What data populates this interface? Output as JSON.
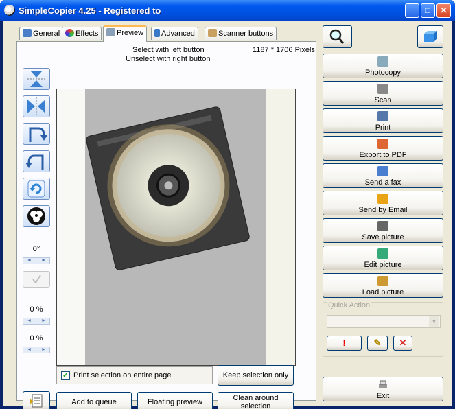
{
  "window": {
    "title": "SimpleCopier 4.25 - Registered to",
    "minimize": "_",
    "maximize": "□",
    "close": "✕"
  },
  "tabs": [
    {
      "label": "General",
      "icon": "general-tab-icon"
    },
    {
      "label": "Effects",
      "icon": "effects-tab-icon"
    },
    {
      "label": "Preview",
      "icon": "preview-tab-icon",
      "active": true
    },
    {
      "label": "Advanced",
      "icon": "advanced-tab-icon"
    },
    {
      "label": "Scanner buttons",
      "icon": "scanner-buttons-tab-icon"
    }
  ],
  "preview": {
    "instructions_line1": "Select with left button",
    "instructions_line2": "Unselect with right button",
    "dimensions": "1187 * 1706 Pixels"
  },
  "side_tools": {
    "rotation_value": "0°",
    "brightness_value": "0 %",
    "contrast_value": "0 %"
  },
  "bottom": {
    "print_selection_label": "Print selection on entire page",
    "print_selection_checked": true,
    "keep_selection_label": "Keep selection only",
    "add_queue_label": "Add to queue",
    "floating_preview_label": "Floating preview",
    "clean_around_label": "Clean around selection"
  },
  "actions": [
    {
      "label": "Photocopy",
      "icon": "photocopy-icon"
    },
    {
      "label": "Scan",
      "icon": "scan-icon"
    },
    {
      "label": "Print",
      "icon": "print-icon"
    },
    {
      "label": "Export to PDF",
      "icon": "export-pdf-icon"
    },
    {
      "label": "Send a fax",
      "icon": "fax-icon"
    },
    {
      "label": "Send by Email",
      "icon": "email-icon"
    },
    {
      "label": "Save picture",
      "icon": "save-picture-icon"
    },
    {
      "label": "Edit picture",
      "icon": "edit-picture-icon"
    },
    {
      "label": "Load picture",
      "icon": "load-picture-icon"
    }
  ],
  "quick_action": {
    "title": "Quick Action",
    "selected": "",
    "run_label": "!",
    "edit_label": "✎",
    "delete_label": "✕"
  },
  "exit_label": "Exit"
}
